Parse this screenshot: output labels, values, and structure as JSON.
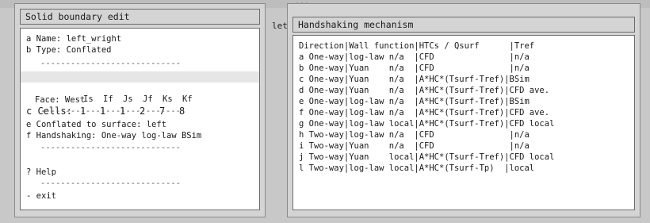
{
  "background": {
    "title_fragment": "...",
    "left_fragment": "let"
  },
  "left_window": {
    "title": "Solid boundary edit",
    "name_item": "a Name: left_wright",
    "type_item": "b Type: Conflated",
    "sep": "----------------------------",
    "cells_header": [
      "Is",
      "If",
      "Js",
      "Jf",
      "Ks",
      "Kf"
    ],
    "cells_label": "c Cells:",
    "cells_values": [
      "1",
      "1",
      "1",
      "2",
      "7",
      "8"
    ],
    "face_item": "Face: West",
    "conflated_item": "e Conflated to surface: left",
    "handshaking_item": "f Handshaking: One-way log-law BSim",
    "help_item": "? Help",
    "exit_item": "- exit"
  },
  "right_window": {
    "title": "Handshaking mechanism",
    "header": "Direction|Wall function|HTCs / Qsurf      |Tref",
    "rows": [
      "a One-way|log-law n/a  |CFD               |n/a",
      "b One-way|Yuan    n/a  |CFD               |n/a",
      "c One-way|Yuan    n/a  |A*HC*(Tsurf-Tref)|BSim",
      "d One-way|Yuan    n/a  |A*HC*(Tsurf-Tref)|CFD ave.",
      "e One-way|log-law n/a  |A*HC*(Tsurf-Tref)|BSim",
      "f One-way|log-law n/a  |A*HC*(Tsurf-Tref)|CFD ave.",
      "g One-way|log-law local|A*HC*(Tsurf-Tref)|CFD local",
      "h Two-way|log-law n/a  |CFD               |n/a",
      "i Two-way|Yuan    n/a  |CFD               |n/a",
      "j Two-way|Yuan    local|A*HC*(Tsurf-Tref)|CFD local",
      "l Two-way|log-law local|A*HC*(Tsurf-Tp)  |local"
    ]
  }
}
